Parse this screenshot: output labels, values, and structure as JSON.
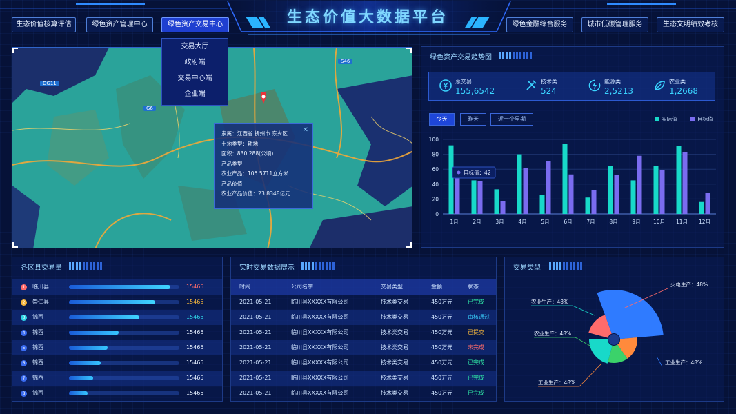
{
  "header": {
    "title": "生态价值大数据平台",
    "nav_left": [
      "生态价值核算评估",
      "绿色资产管理中心",
      "绿色资产交易中心"
    ],
    "nav_right": [
      "绿色金融综合服务",
      "城市低碳管理服务",
      "生态文明绩效考核"
    ],
    "active_nav": "绿色资产交易中心",
    "dropdown": [
      "交易大厅",
      "政府端",
      "交易中心端",
      "企业端"
    ]
  },
  "map": {
    "road_labels": [
      "S46",
      "DG11",
      "G6"
    ],
    "popup": {
      "line1": "隶属：江西省 抚州市 东乡区",
      "line2": "土地类型：耕地",
      "line3": "面积：830.288(公顷)",
      "line4": "产品类型",
      "line5": "农业产品：105.5711立方米",
      "line6": "产品价值",
      "line7": "农业产品价值：23.8348亿元",
      "close": "✕"
    }
  },
  "trend": {
    "title": "绿色资产交易趋势图",
    "stats": [
      {
        "label": "总交易",
        "value": "155,6542",
        "icon": "yen-coin-icon"
      },
      {
        "label": "技术类",
        "value": "524",
        "icon": "tools-icon"
      },
      {
        "label": "能源类",
        "value": "2,5213",
        "icon": "energy-icon"
      },
      {
        "label": "农业类",
        "value": "1,2668",
        "icon": "leaf-icon"
      }
    ],
    "tabs": [
      "今天",
      "昨天",
      "近一个星期"
    ],
    "active_tab": "今天",
    "tooltip": "目标值：42"
  },
  "chart_data": {
    "type": "bar",
    "categories": [
      "1月",
      "2月",
      "3月",
      "4月",
      "5月",
      "6月",
      "7月",
      "8月",
      "9月",
      "10月",
      "11月",
      "12月"
    ],
    "series": [
      {
        "name": "实际值",
        "color": "#18d9c9",
        "values": [
          92,
          45,
          33,
          80,
          25,
          94,
          22,
          64,
          45,
          64,
          91,
          16
        ]
      },
      {
        "name": "目标值",
        "color": "#7a6cf0",
        "values": [
          53,
          44,
          17,
          62,
          71,
          53,
          32,
          52,
          78,
          59,
          83,
          28
        ]
      }
    ],
    "yticks": [
      0,
      20,
      40,
      60,
      80,
      100
    ],
    "ylim": [
      0,
      100
    ],
    "legend": "top-right"
  },
  "districts": {
    "title": "各区县交易量",
    "rows": [
      {
        "rank": "1",
        "name": "临川县",
        "value": "15465",
        "pct": 0.92,
        "color": "#ff6b6b"
      },
      {
        "rank": "2",
        "name": "崇仁县",
        "value": "15465",
        "pct": 0.78,
        "color": "#f6b73c"
      },
      {
        "rank": "3",
        "name": "锦西",
        "value": "15465",
        "pct": 0.64,
        "color": "#2fd4e6"
      },
      {
        "rank": "4",
        "name": "锦西",
        "value": "15465",
        "pct": 0.45,
        "color": "#3b6cf0"
      },
      {
        "rank": "5",
        "name": "锦西",
        "value": "15465",
        "pct": 0.35,
        "color": "#3b6cf0"
      },
      {
        "rank": "6",
        "name": "锦西",
        "value": "15465",
        "pct": 0.29,
        "color": "#3b6cf0"
      },
      {
        "rank": "7",
        "name": "锦西",
        "value": "15465",
        "pct": 0.22,
        "color": "#3b6cf0"
      },
      {
        "rank": "8",
        "name": "锦西",
        "value": "15465",
        "pct": 0.17,
        "color": "#3b6cf0"
      }
    ]
  },
  "realtime": {
    "title": "实时交易数据展示",
    "headers": [
      "时间",
      "公司名字",
      "交易类型",
      "金额",
      "状态"
    ],
    "rows": [
      {
        "time": "2021-05-21",
        "company": "临川县XXXXX有限公司",
        "type": "技术类交易",
        "amount": "450万元",
        "status": "已完成",
        "status_color": "#2fe3a5"
      },
      {
        "time": "2021-05-21",
        "company": "临川县XXXXX有限公司",
        "type": "技术类交易",
        "amount": "450万元",
        "status": "审核通过",
        "status_color": "#3ad3ff"
      },
      {
        "time": "2021-05-21",
        "company": "临川县XXXXX有限公司",
        "type": "技术类交易",
        "amount": "450万元",
        "status": "已提交",
        "status_color": "#f6b73c"
      },
      {
        "time": "2021-05-21",
        "company": "临川县XXXXX有限公司",
        "type": "技术类交易",
        "amount": "450万元",
        "status": "未完成",
        "status_color": "#ff6b6b"
      },
      {
        "time": "2021-05-21",
        "company": "临川县XXXXX有限公司",
        "type": "技术类交易",
        "amount": "450万元",
        "status": "已完成",
        "status_color": "#2fe3a5"
      },
      {
        "time": "2021-05-21",
        "company": "临川县XXXXX有限公司",
        "type": "技术类交易",
        "amount": "450万元",
        "status": "已完成",
        "status_color": "#2fe3a5"
      },
      {
        "time": "2021-05-21",
        "company": "临川县XXXXX有限公司",
        "type": "技术类交易",
        "amount": "450万元",
        "status": "已完成",
        "status_color": "#2fe3a5"
      }
    ]
  },
  "types": {
    "title": "交易类型",
    "slices": [
      {
        "label": "火电生产：48%",
        "color": "#ff6b6b"
      },
      {
        "label": "工业生产：48%",
        "color": "#2f7bff"
      },
      {
        "label": "工业生产：48%",
        "color": "#ff8a3c"
      },
      {
        "label": "农业生产：48%",
        "color": "#3bd26a"
      },
      {
        "label": "农业生产：48%",
        "color": "#18d9c9"
      }
    ]
  }
}
